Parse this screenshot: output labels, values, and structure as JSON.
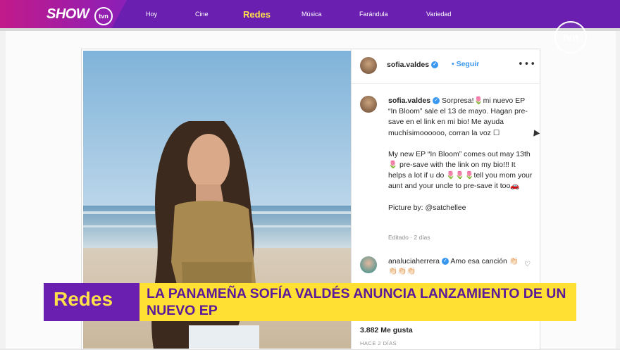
{
  "header": {
    "brand": "SHOW",
    "brand_badge": "tvn",
    "nav": [
      {
        "label": "Hoy"
      },
      {
        "label": "Cine"
      },
      {
        "label": "Redes",
        "active": true
      },
      {
        "label": "Música"
      },
      {
        "label": "Farándula"
      },
      {
        "label": "Variedad"
      }
    ]
  },
  "watermark": "tvn",
  "post": {
    "username": "sofia.valdes",
    "follow_label": "Seguir",
    "more_label": "•••",
    "caption_es": "Sorpresa!🌷mi nuevo EP “In Bloom” sale el 13 de mayo. Hagan pre-save en el link en mi bio! Me ayuda muchísimoooooo, corran la voz ☐",
    "caption_en": "My new EP “In Bloom” comes out may 13th 🌷 pre-save with the link on my bio!!! It helps a lot if u do 🌷🌷🌷tell you mom your aunt and your uncle to pre-save it too🚗",
    "credit": "Picture by: @satchellee",
    "edited": "Editado · 2 días",
    "comment": {
      "username": "analuciaherrera",
      "text": "Amo esa canción 👏🏻👏🏻👏🏻👏🏻"
    },
    "likes": "3.882 Me gusta",
    "date": "HACE 2 DÍAS"
  },
  "lower_third": {
    "tag": "Redes",
    "headline": "LA PANAMEÑA SOFÍA VALDÉS ANUNCIA LANZAMIENTO DE UN NUEVO EP"
  }
}
